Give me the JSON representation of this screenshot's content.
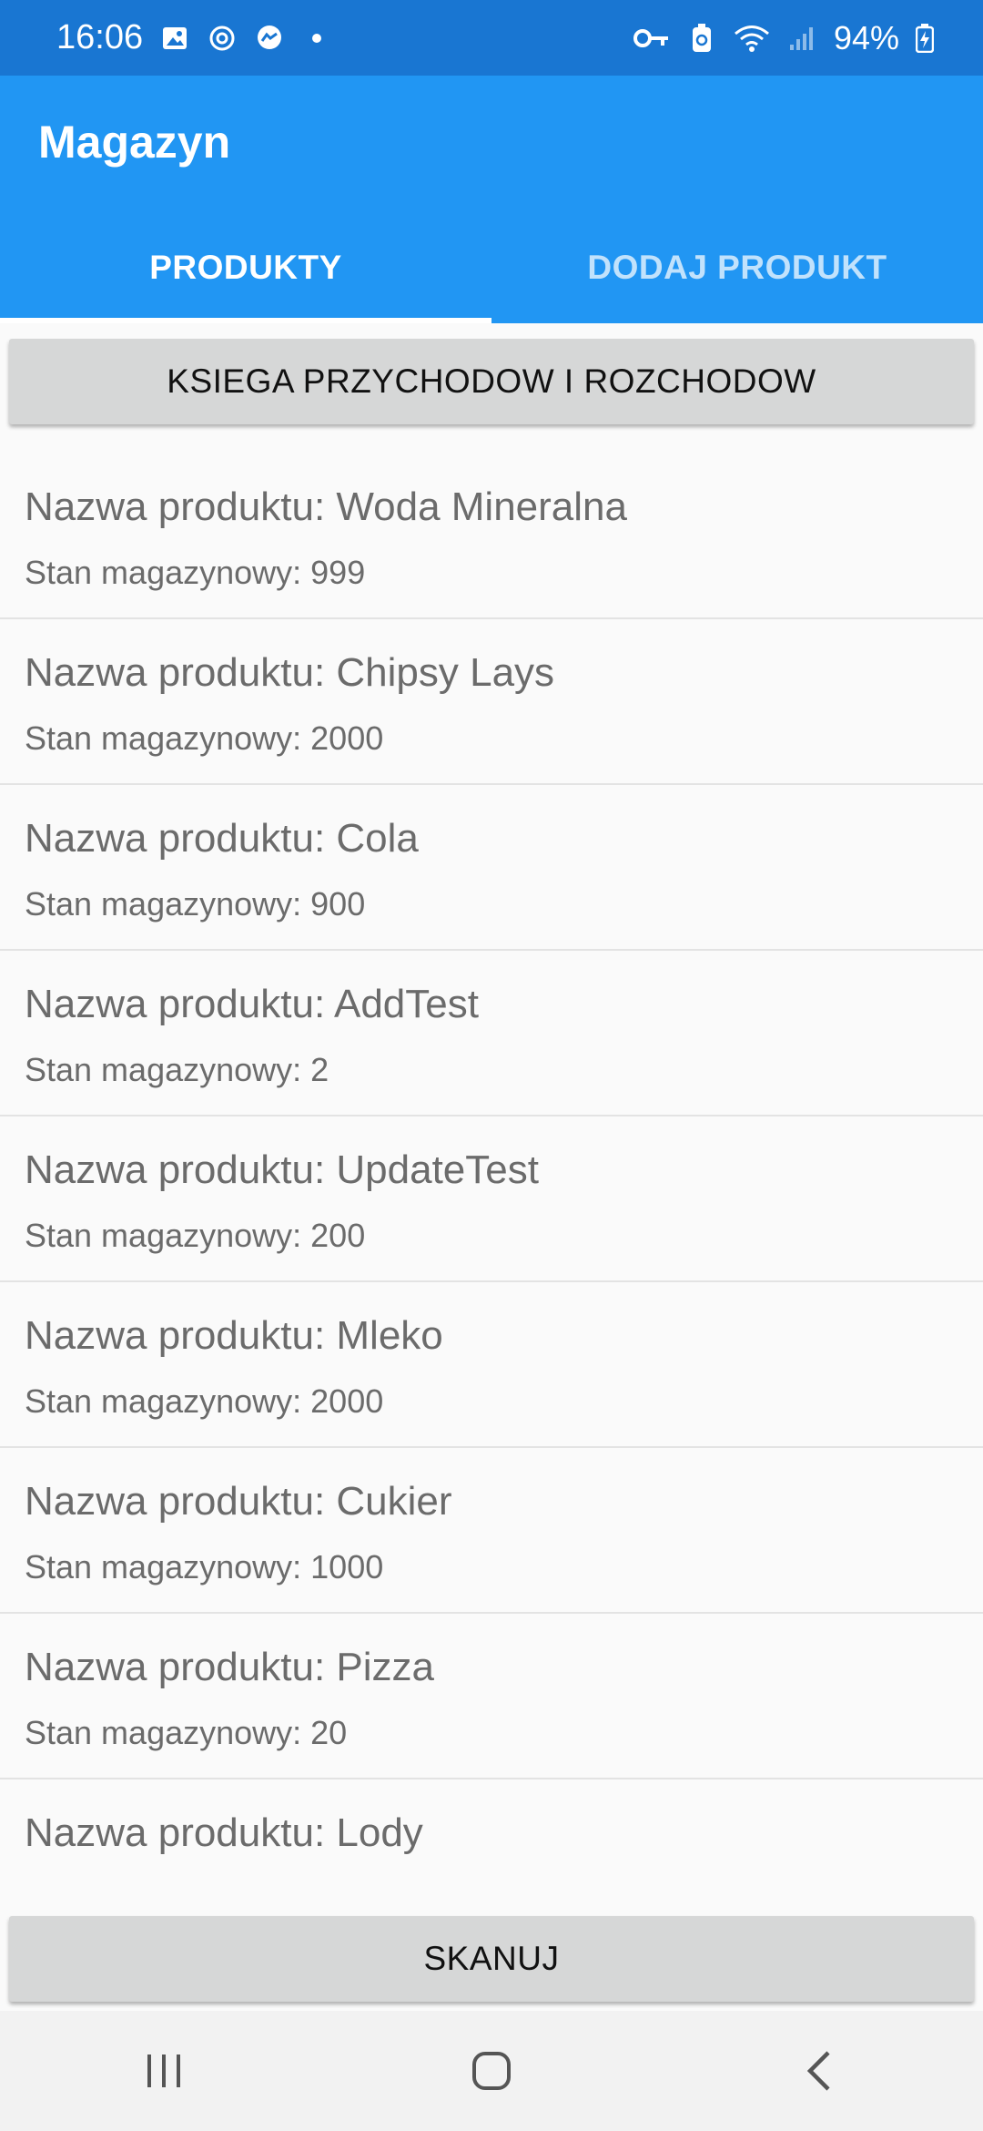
{
  "status_bar": {
    "time": "16:06",
    "battery": "94%",
    "icons_left": [
      "gallery-icon",
      "sync-icon",
      "messenger-icon",
      "dot-icon"
    ],
    "icons_right": [
      "key-icon",
      "battery-saver-icon",
      "wifi-icon",
      "signal-icon",
      "battery-charging-icon"
    ]
  },
  "app_bar": {
    "title": "Magazyn",
    "tabs": [
      {
        "label": "PRODUKTY",
        "active": true
      },
      {
        "label": "DODAJ PRODUKT",
        "active": false
      }
    ]
  },
  "ledger_button": "KSIEGA PRZYCHODOW I ROZCHODOW",
  "products": [
    {
      "name": "Nazwa produktu: Woda Mineralna",
      "stock": "Stan magazynowy: 999"
    },
    {
      "name": "Nazwa produktu: Chipsy Lays",
      "stock": "Stan magazynowy: 2000"
    },
    {
      "name": "Nazwa produktu: Cola",
      "stock": "Stan magazynowy: 900"
    },
    {
      "name": "Nazwa produktu: AddTest",
      "stock": "Stan magazynowy: 2"
    },
    {
      "name": "Nazwa produktu: UpdateTest",
      "stock": "Stan magazynowy: 200"
    },
    {
      "name": "Nazwa produktu: Mleko",
      "stock": "Stan magazynowy: 2000"
    },
    {
      "name": "Nazwa produktu: Cukier",
      "stock": "Stan magazynowy: 1000"
    },
    {
      "name": "Nazwa produktu: Pizza",
      "stock": "Stan magazynowy: 20"
    },
    {
      "name": "Nazwa produktu: Lody",
      "stock": ""
    }
  ],
  "scan_button": "SKANUJ",
  "nav_bar": [
    "recents-icon",
    "home-icon",
    "back-icon"
  ],
  "colors": {
    "status_bar": "#1976d2",
    "app_bar": "#2196f3",
    "button_bg": "#d6d7d7",
    "list_text": "#6b6b6b"
  }
}
